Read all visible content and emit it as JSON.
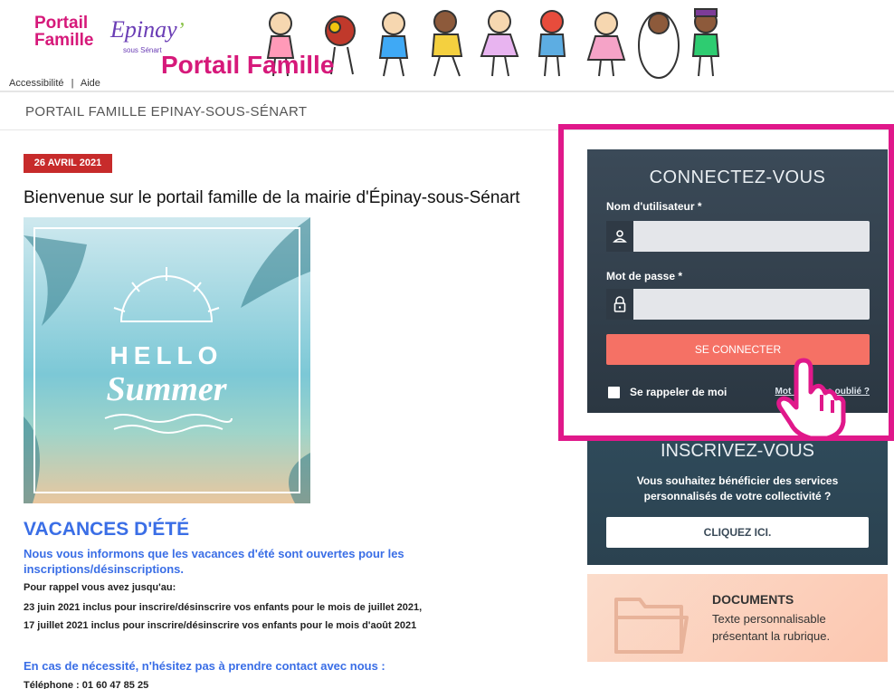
{
  "header": {
    "logo_line1": "Portail",
    "logo_line2": "Famille",
    "logo_town": "Epinay",
    "logo_town_sub": "sous Sénart",
    "title": "Portail Famille",
    "links": [
      "Accessibilité",
      "|",
      "Aide"
    ]
  },
  "breadcrumb": "PORTAIL FAMILLE EPINAY-SOUS-SÉNART",
  "article": {
    "date": "26 AVRIL 2021",
    "headline": "Bienvenue sur le portail famille de la mairie d'Épinay-sous-Sénart",
    "image_text_line1": "HELLO",
    "image_text_line2": "Summer",
    "vacances_title": "VACANCES D'ÉTÉ",
    "vacances_sub": "Nous vous informons que les vacances d'été sont ouvertes pour les inscriptions/désinscriptions.",
    "rappel": "Pour rappel vous avez jusqu'au:",
    "line1": "23 juin 2021 inclus pour inscrire/désinscrire vos enfants pour le mois de juillet 2021,",
    "line2": "17 juillet 2021 inclus pour inscrire/désinscrire vos enfants pour le mois d'août 2021",
    "contact": "En cas de nécessité, n'hésitez pas à prendre contact avec nous :",
    "phone": "Téléphone : 01 60 47 85 25"
  },
  "login": {
    "title": "CONNECTEZ-VOUS",
    "username_label": "Nom d'utilisateur *",
    "username_value": "",
    "password_label": "Mot de passe *",
    "password_value": "",
    "submit": "SE CONNECTER",
    "remember": "Se rappeler de moi",
    "forgot": "Mot de passe oublié ?"
  },
  "register": {
    "title": "INSCRIVEZ-VOUS",
    "text": "Vous souhaitez bénéficier des services personnalisés de votre collectivité ?",
    "button": "CLIQUEZ ICI."
  },
  "documents": {
    "title": "DOCUMENTS",
    "text": "Texte personnalisable présentant la rubrique."
  },
  "colors": {
    "brand_pink": "#d6197a",
    "highlight_frame": "#e0188a",
    "login_button": "#f57165",
    "panel_dark": "#2b3742",
    "link_blue": "#3a6ee6",
    "date_red": "#c72b2b"
  }
}
